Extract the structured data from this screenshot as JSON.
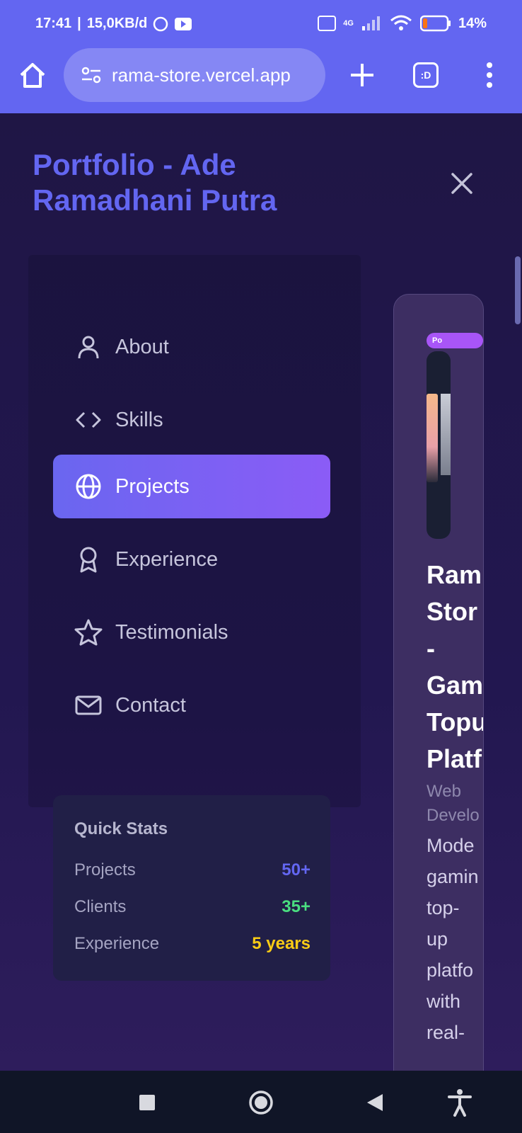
{
  "status_bar": {
    "time": "17:41",
    "data_rate": "15,0KB/d",
    "network": "4G",
    "battery": "14%"
  },
  "browser": {
    "url": "rama-store.vercel.app",
    "tabs_label": ":D"
  },
  "site": {
    "brand_title": "Portfolio - Ade Ramadhani Putra"
  },
  "nav_items": [
    {
      "label": "About",
      "icon": "user-icon"
    },
    {
      "label": "Skills",
      "icon": "code-icon"
    },
    {
      "label": "Projects",
      "icon": "globe-icon",
      "active": true
    },
    {
      "label": "Experience",
      "icon": "award-icon"
    },
    {
      "label": "Testimonials",
      "icon": "star-icon"
    },
    {
      "label": "Contact",
      "icon": "mail-icon"
    }
  ],
  "quick_stats": {
    "title": "Quick Stats",
    "rows": [
      {
        "label": "Projects",
        "value": "50+",
        "color": "#6366f1"
      },
      {
        "label": "Clients",
        "value": "35+",
        "color": "#4ade80"
      },
      {
        "label": "Experience",
        "value": "5 years",
        "color": "#facc15"
      }
    ]
  },
  "project_card": {
    "badge": "Po",
    "title": "Ram\nStor\n-\nGam\nTopu\nPlatf",
    "category": "Web\nDevelo",
    "description": "Mode\ngamin\ntop-\nup\nplatfo\nwith\nreal-"
  },
  "colors": {
    "accent": "#6366f1",
    "accent2": "#8b5cf6",
    "background": "#1e1646"
  }
}
